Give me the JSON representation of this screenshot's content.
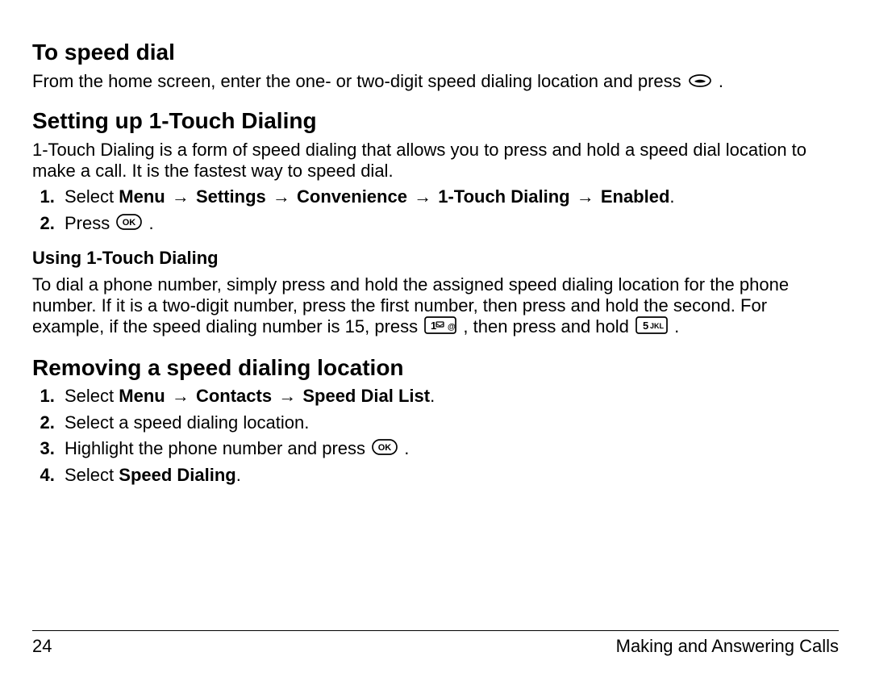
{
  "section1": {
    "heading": "To speed dial",
    "p1_before_icon": "From the home screen, enter the one- or two-digit speed dialing location and press ",
    "p1_after_icon": "."
  },
  "section2": {
    "heading": "Setting up 1-Touch Dialing",
    "intro": "1-Touch Dialing is a form of speed dialing that allows you to press and hold a speed dial location to make a call. It is the fastest way to speed dial.",
    "step1_select": "Select ",
    "step1_path_menu": "Menu",
    "step1_path_settings": "Settings",
    "step1_path_convenience": "Convenience",
    "step1_path_1touch": "1-Touch Dialing",
    "step1_path_enabled": "Enabled",
    "step1_period": ".",
    "step2_press": "Press ",
    "step2_period": ".",
    "sub_heading": "Using 1-Touch Dialing",
    "sub_p_a": "To dial a phone number, simply press and hold the assigned speed dialing location for the phone number. If it is a two-digit number, press the first number, then press and hold the second. For example, if the speed dialing number is 15, press ",
    "sub_p_b": ", then press and hold ",
    "sub_p_c": "."
  },
  "section3": {
    "heading": "Removing a speed dialing location",
    "step1_select": "Select ",
    "step1_path_menu": "Menu",
    "step1_path_contacts": "Contacts",
    "step1_path_sdl": "Speed Dial List",
    "step1_period": ".",
    "step2": "Select a speed dialing location.",
    "step3_a": "Highlight the phone number and press ",
    "step3_b": ".",
    "step4_a": "Select ",
    "step4_b": "Speed Dialing",
    "step4_c": "."
  },
  "footer": {
    "page": "24",
    "title": "Making and Answering Calls"
  },
  "arrow": "→"
}
